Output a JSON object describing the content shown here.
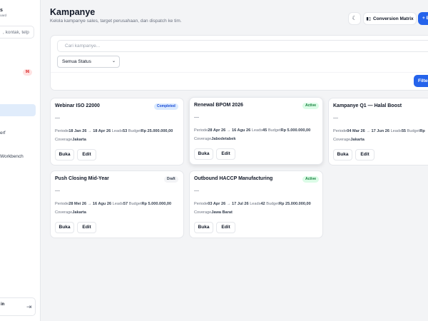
{
  "sidebar": {
    "brand": "s",
    "brand_sub": "oard",
    "search_placeholder": ", kontak, telp",
    "badge_count": "96",
    "items": [
      {
        "label": "erf"
      },
      {
        "label": "Workbench"
      }
    ],
    "user_name": "in",
    "logout_icon": "logout-icon"
  },
  "header": {
    "title": "Kampanye",
    "subtitle": "Kelola kampanye sales, target perusahaan, dan dispatch ke tim.",
    "theme_icon": "moon-icon",
    "conversion_label": "Conversion Matrix",
    "conversion_icon": "chart-bar-icon",
    "add_label": "+ B"
  },
  "filters": {
    "search_placeholder": "Cari kampanye...",
    "status_selected": "Semua Status",
    "filter_label": "Filter"
  },
  "labels": {
    "periode": "Periode",
    "leads": "Leads",
    "budget": "Budget",
    "coverage": "Coverage",
    "open": "Buka",
    "edit": "Edit",
    "arrow": "→"
  },
  "campaigns": [
    {
      "title": "Webinar ISO 22000",
      "status": "Completed",
      "desc": "—",
      "start": "18 Jan 26",
      "end": "18 Apr 26",
      "leads": "53",
      "budget": "Rp 25.000.000,00",
      "coverage": "Jakarta"
    },
    {
      "title": "Renewal BPOM 2026",
      "status": "Active",
      "desc": "—",
      "start": "28 Apr 26",
      "end": "16 Agu 26",
      "leads": "45",
      "budget": "Rp 5.000.000,00",
      "coverage": "Jabodetabek"
    },
    {
      "title": "Kampanye Q1 — Halal Boost",
      "status": "",
      "desc": "—",
      "start": "04 Mar 26",
      "end": "17 Jun 26",
      "leads": "55",
      "budget": "Rp",
      "coverage": "Jakarta"
    },
    {
      "title": "Push Closing Mid-Year",
      "status": "Draft",
      "desc": "—",
      "start": "28 Mei 26",
      "end": "16 Agu 26",
      "leads": "57",
      "budget": "Rp 5.000.000,00",
      "coverage": "Jakarta"
    },
    {
      "title": "Outbound HACCP Manufacturing",
      "status": "Active",
      "desc": "—",
      "start": "03 Apr 26",
      "end": "17 Jul 26",
      "leads": "42",
      "budget": "Rp 25.000.000,00",
      "coverage": "Jawa Barat"
    }
  ],
  "colors": {
    "primary": "#2563eb",
    "completed": "#1d4ed8",
    "active": "#15803d",
    "draft": "#374151",
    "danger": "#dc2626"
  }
}
